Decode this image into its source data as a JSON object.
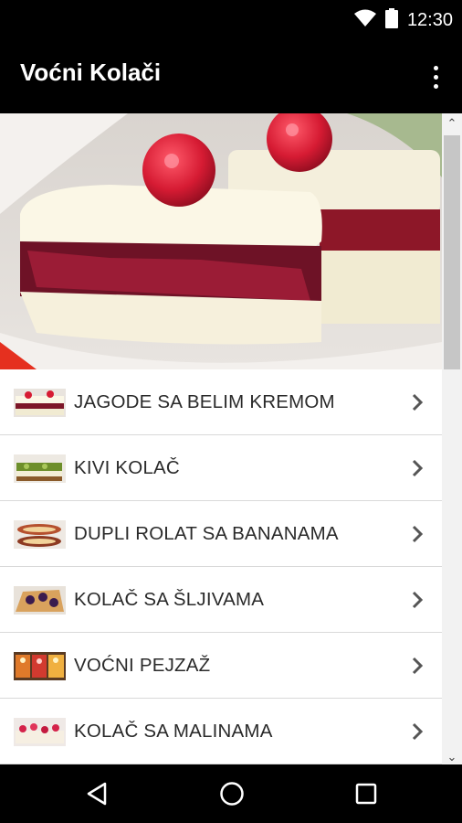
{
  "status_bar": {
    "time": "12:30",
    "icons": [
      "wifi-icon",
      "battery-icon"
    ]
  },
  "app_bar": {
    "title": "Voćni Kolači",
    "menu_icon": "more-vert-icon"
  },
  "hero_image": "cake-with-strawberries",
  "recipes": [
    {
      "label": "JAGODE SA BELIM KREMOM",
      "thumbnail": "strawberry-cream-cake"
    },
    {
      "label": "KIVI KOLAČ",
      "thumbnail": "kiwi-cake"
    },
    {
      "label": "DUPLI ROLAT SA BANANAMA",
      "thumbnail": "banana-roll"
    },
    {
      "label": "KOLAČ SA ŠLJIVAMA",
      "thumbnail": "plum-cake"
    },
    {
      "label": "VOĆNI PEJZAŽ",
      "thumbnail": "fruit-landscape"
    },
    {
      "label": "KOLAČ SA MALINAMA",
      "thumbnail": "raspberry-cake"
    }
  ],
  "nav_bar": {
    "buttons": [
      "back-icon",
      "home-icon",
      "recents-icon"
    ]
  },
  "colors": {
    "bar_background": "#000000",
    "list_background": "#ffffff",
    "divider": "#d9d9d9",
    "text": "#2a2a2a"
  }
}
